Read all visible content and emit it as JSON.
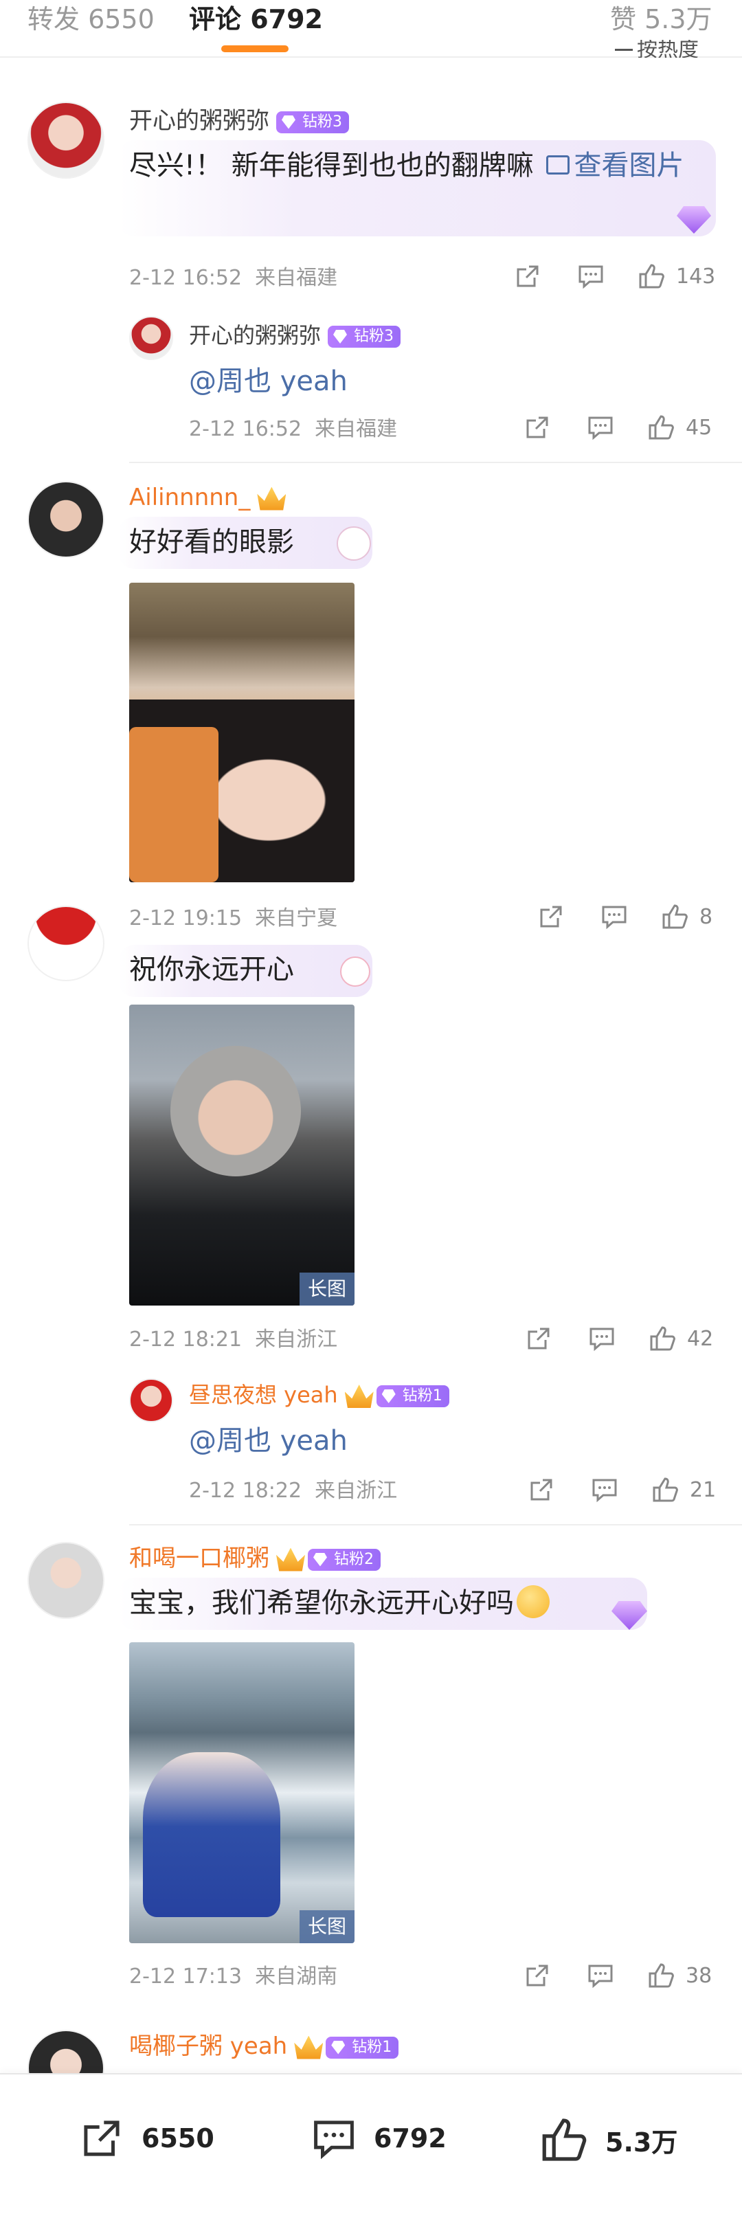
{
  "tabs": {
    "repost": "转发 6550",
    "comment": "评论 6792",
    "like": "赞 5.3万",
    "sort": "按热度"
  },
  "comments": [
    {
      "user": "开心的粥粥弥",
      "badge": "钻粉3",
      "text": "尽兴!！ 新年能得到也也的翻牌嘛",
      "link": "查看图片",
      "time": "2-12 16:52",
      "location": "来自福建",
      "likes": "143",
      "reply": {
        "user": "开心的粥粥弥",
        "badge": "钻粉3",
        "text": "@周也 yeah",
        "time": "2-12 16:52",
        "location": "来自福建",
        "likes": "45"
      }
    },
    {
      "user": "Ailinnnnn_",
      "text": "好好看的眼影",
      "time": "2-12 19:15",
      "location": "来自宁夏",
      "likes": "8"
    },
    {
      "text": "祝你永远开心",
      "long_label": "长图",
      "time": "2-12 18:21",
      "location": "来自浙江",
      "likes": "42",
      "reply": {
        "user": "昼思夜想 yeah",
        "badge": "钻粉1",
        "text": "@周也 yeah",
        "time": "2-12 18:22",
        "location": "来自浙江",
        "likes": "21"
      }
    },
    {
      "user": "和喝一口椰粥",
      "badge": "钻粉2",
      "text": "宝宝，我们希望你永远开心好吗",
      "long_label": "长图",
      "time": "2-12 17:13",
      "location": "来自湖南",
      "likes": "38"
    },
    {
      "user": "喝椰子粥 yeah",
      "badge": "钻粉1"
    }
  ],
  "bottom_bar": {
    "repost": "6550",
    "comment": "6792",
    "like": "5.3万"
  },
  "colors": {
    "accent": "#ff8a1f",
    "username_orange": "#f07828",
    "link": "#4b6ea8",
    "badge_purple": "#a874fb"
  }
}
